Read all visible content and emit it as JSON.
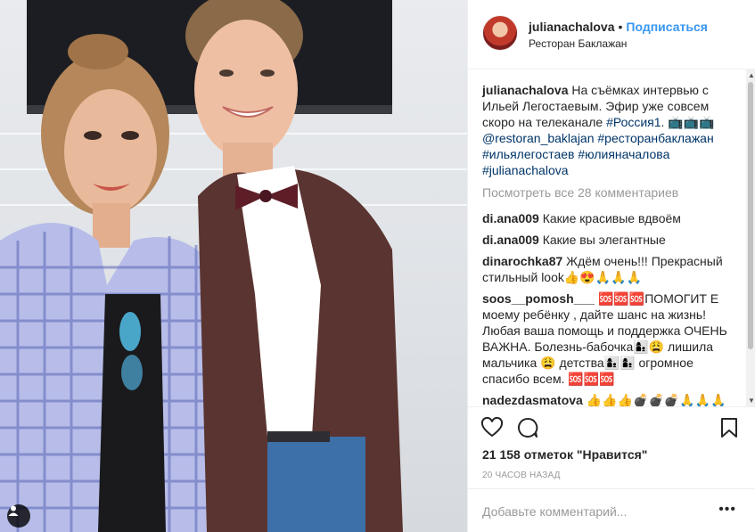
{
  "header": {
    "username": "julianachalova",
    "separator": "•",
    "follow_label": "Подписаться",
    "location": "Ресторан Баклажан"
  },
  "caption": {
    "username": "julianachalova",
    "text": "На съёмках интервью с Ильей Легостаевым. Эфир уже совсем скоро на телеканале",
    "hashtag_channel": "#Россия1",
    "after_channel": ". 📺📺📺",
    "tags_line": "@restoran_baklajan #ресторанбаклажан #ильялегостаев #юлияначалова #julianachalova"
  },
  "view_all_label": "Посмотреть все 28 комментариев",
  "comments": [
    {
      "username": "di.ana009",
      "text": "Какие красивые вдвоём"
    },
    {
      "username": "di.ana009",
      "text": "Какие вы элегантные"
    },
    {
      "username": "dinarochka87",
      "text": "Ждём очень!!! Прекрасный стильный look👍😍🙏🙏🙏"
    },
    {
      "username": "soos__pomosh___",
      "text": "🆘🆘🆘ПОМОГИТ Е моему ребёнку , дайте шанс на жизнь! Любая ваша помощь и поддержка ОЧЕНЬ ВАЖНА. Болезнь-бабочка👩‍👦😩 лишила мальчика 😩 детства👩‍👦👩‍👦 огромное спасибо всем. 🆘🆘🆘"
    },
    {
      "username": "nadezdasmatova",
      "text": "👍👍👍💣💣💣🙏🙏🙏"
    }
  ],
  "likes_label": "21 158 отметок \"Нравится\"",
  "time_label": "20 ЧАСОВ НАЗАД",
  "add_comment_placeholder": "Добавьте комментарий...",
  "more_label": "•••",
  "icons": {
    "like": "heart-icon",
    "comment": "comment-bubble-icon",
    "save": "bookmark-icon",
    "tag": "person-tag-icon"
  },
  "colors": {
    "accent": "#3897f0",
    "hashtag": "#003569",
    "text": "#262626",
    "muted": "#999999"
  }
}
